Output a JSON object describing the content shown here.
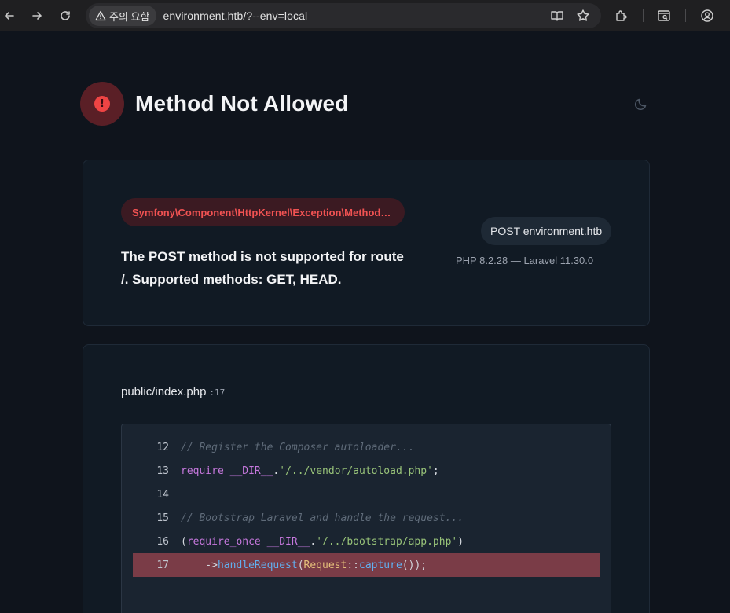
{
  "browser": {
    "warning_label": "주의 요함",
    "url": "environment.htb/?--env=local"
  },
  "page": {
    "title": "Method Not Allowed",
    "exception_class": "Symfony\\Component\\HttpKernel\\Exception\\MethodNotAllowedHttpException",
    "message": "The POST method is not supported for route /. Supported methods: GET, HEAD.",
    "request": "POST environment.htb",
    "versions": "PHP 8.2.28 — Laravel 11.30.0",
    "file": "public/index.php",
    "file_line": ":17",
    "code_lines": [
      {
        "no": "12",
        "parts": [
          {
            "t": "// Register the Composer autoloader...",
            "c": "c-comment"
          }
        ]
      },
      {
        "no": "13",
        "parts": [
          {
            "t": "require",
            "c": "c-kw"
          },
          {
            "t": " ",
            "c": "c-plain"
          },
          {
            "t": "__DIR__",
            "c": "c-kw"
          },
          {
            "t": ".",
            "c": "c-plain"
          },
          {
            "t": "'/../vendor/autoload.php'",
            "c": "c-str"
          },
          {
            "t": ";",
            "c": "c-plain"
          }
        ]
      },
      {
        "no": "14",
        "parts": []
      },
      {
        "no": "15",
        "parts": [
          {
            "t": "// Bootstrap Laravel and handle the request...",
            "c": "c-comment"
          }
        ]
      },
      {
        "no": "16",
        "parts": [
          {
            "t": "(",
            "c": "c-plain"
          },
          {
            "t": "require_once",
            "c": "c-kw"
          },
          {
            "t": " ",
            "c": "c-plain"
          },
          {
            "t": "__DIR__",
            "c": "c-kw"
          },
          {
            "t": ".",
            "c": "c-plain"
          },
          {
            "t": "'/../bootstrap/app.php'",
            "c": "c-str"
          },
          {
            "t": ")",
            "c": "c-plain"
          }
        ]
      },
      {
        "no": "17",
        "highlight": true,
        "parts": [
          {
            "t": "    ->",
            "c": "c-plain"
          },
          {
            "t": "handleRequest",
            "c": "c-fn"
          },
          {
            "t": "(",
            "c": "c-plain"
          },
          {
            "t": "Request",
            "c": "c-cls"
          },
          {
            "t": "::",
            "c": "c-plain"
          },
          {
            "t": "capture",
            "c": "c-fn"
          },
          {
            "t": "());",
            "c": "c-plain"
          }
        ]
      }
    ]
  },
  "colors": {
    "error_accent": "#ef4444",
    "highlight_row": "#7a3c47"
  }
}
